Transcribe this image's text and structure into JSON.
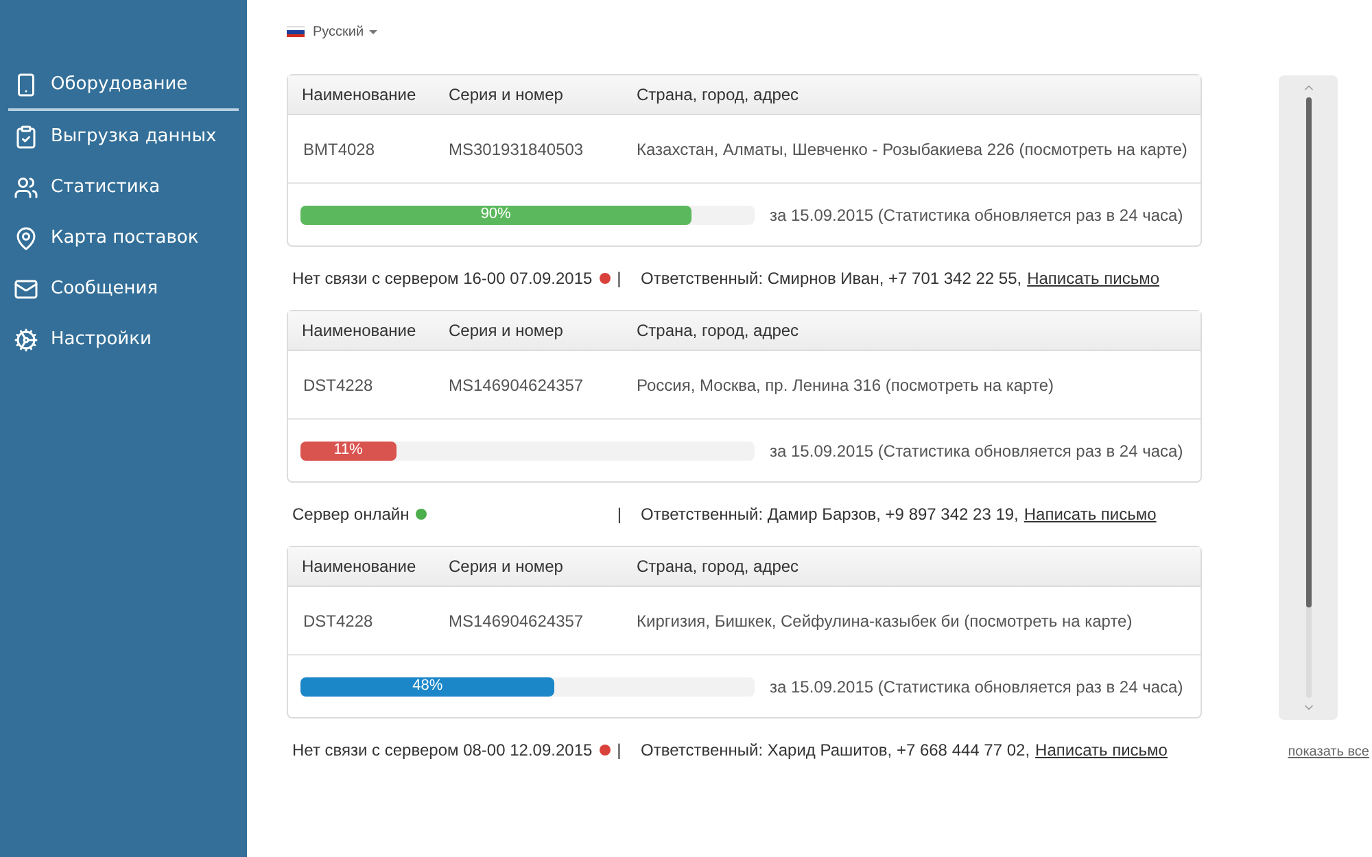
{
  "sidebar": {
    "items": [
      {
        "label": "Оборудование",
        "selected": true
      },
      {
        "label": "Выгрузка данных",
        "selected": false
      },
      {
        "label": "Статистика",
        "selected": false
      },
      {
        "label": "Карта поставок",
        "selected": false
      },
      {
        "label": "Сообщения",
        "selected": false
      },
      {
        "label": "Настройки",
        "selected": false
      }
    ]
  },
  "language": {
    "label": "Русский"
  },
  "devices": [
    {
      "columns": [
        "Наименование",
        "Серия и номер",
        "Страна, город, адрес"
      ],
      "name": "BMT4028",
      "serial": "MS301931840503",
      "address": "Казахстан, Алматы, Шевченко - Розыбакиева 226 (посмотреть на карте)",
      "level": 0.86,
      "percent": "90%",
      "color": "#5cb85c",
      "stats": "за 15.09.2015 (Статистика обновляется раз в 24 часа)",
      "status": "Нет связи с сервером 16-00 07.09.2015",
      "online": false,
      "separator": "|",
      "responsible": "Ответственный: Смирнов Иван, +7 701 342 22 55,",
      "link": "Написать письмо"
    },
    {
      "columns": [
        "Наименование",
        "Серия и номер",
        "Страна, город, адрес"
      ],
      "name": "DST4228",
      "serial": "MS146904624357",
      "address": "Россия, Москва, пр. Ленина 316 (посмотреть на карте)",
      "level": 0.21,
      "percent": "11%",
      "color": "#d9534f",
      "stats": "за 15.09.2015 (Статистика обновляется раз в 24 часа)",
      "status": "Сервер онлайн",
      "online": true,
      "separator": "|",
      "responsible": "Ответственный: Дамир Барзов, +9 897 342 23 19,",
      "link": "Написать письмо"
    },
    {
      "columns": [
        "Наименование",
        "Серия и номер",
        "Страна, город, адрес"
      ],
      "name": "DST4228",
      "serial": "MS146904624357",
      "address": "Киргизия, Бишкек, Сейфулина-казыбек би (посмотреть на карте)",
      "level": 0.56,
      "percent": "48%",
      "color": "#1b87c9",
      "stats": "за 15.09.2015 (Статистика обновляется раз в 24 часа)",
      "status": "Нет связи с сервером 08-00 12.09.2015",
      "online": false,
      "separator": "|",
      "responsible": "Ответственный: Харид Рашитов, +7 668 444 77 02,",
      "link": "Написать письмо"
    }
  ],
  "show_all": "показать все"
}
